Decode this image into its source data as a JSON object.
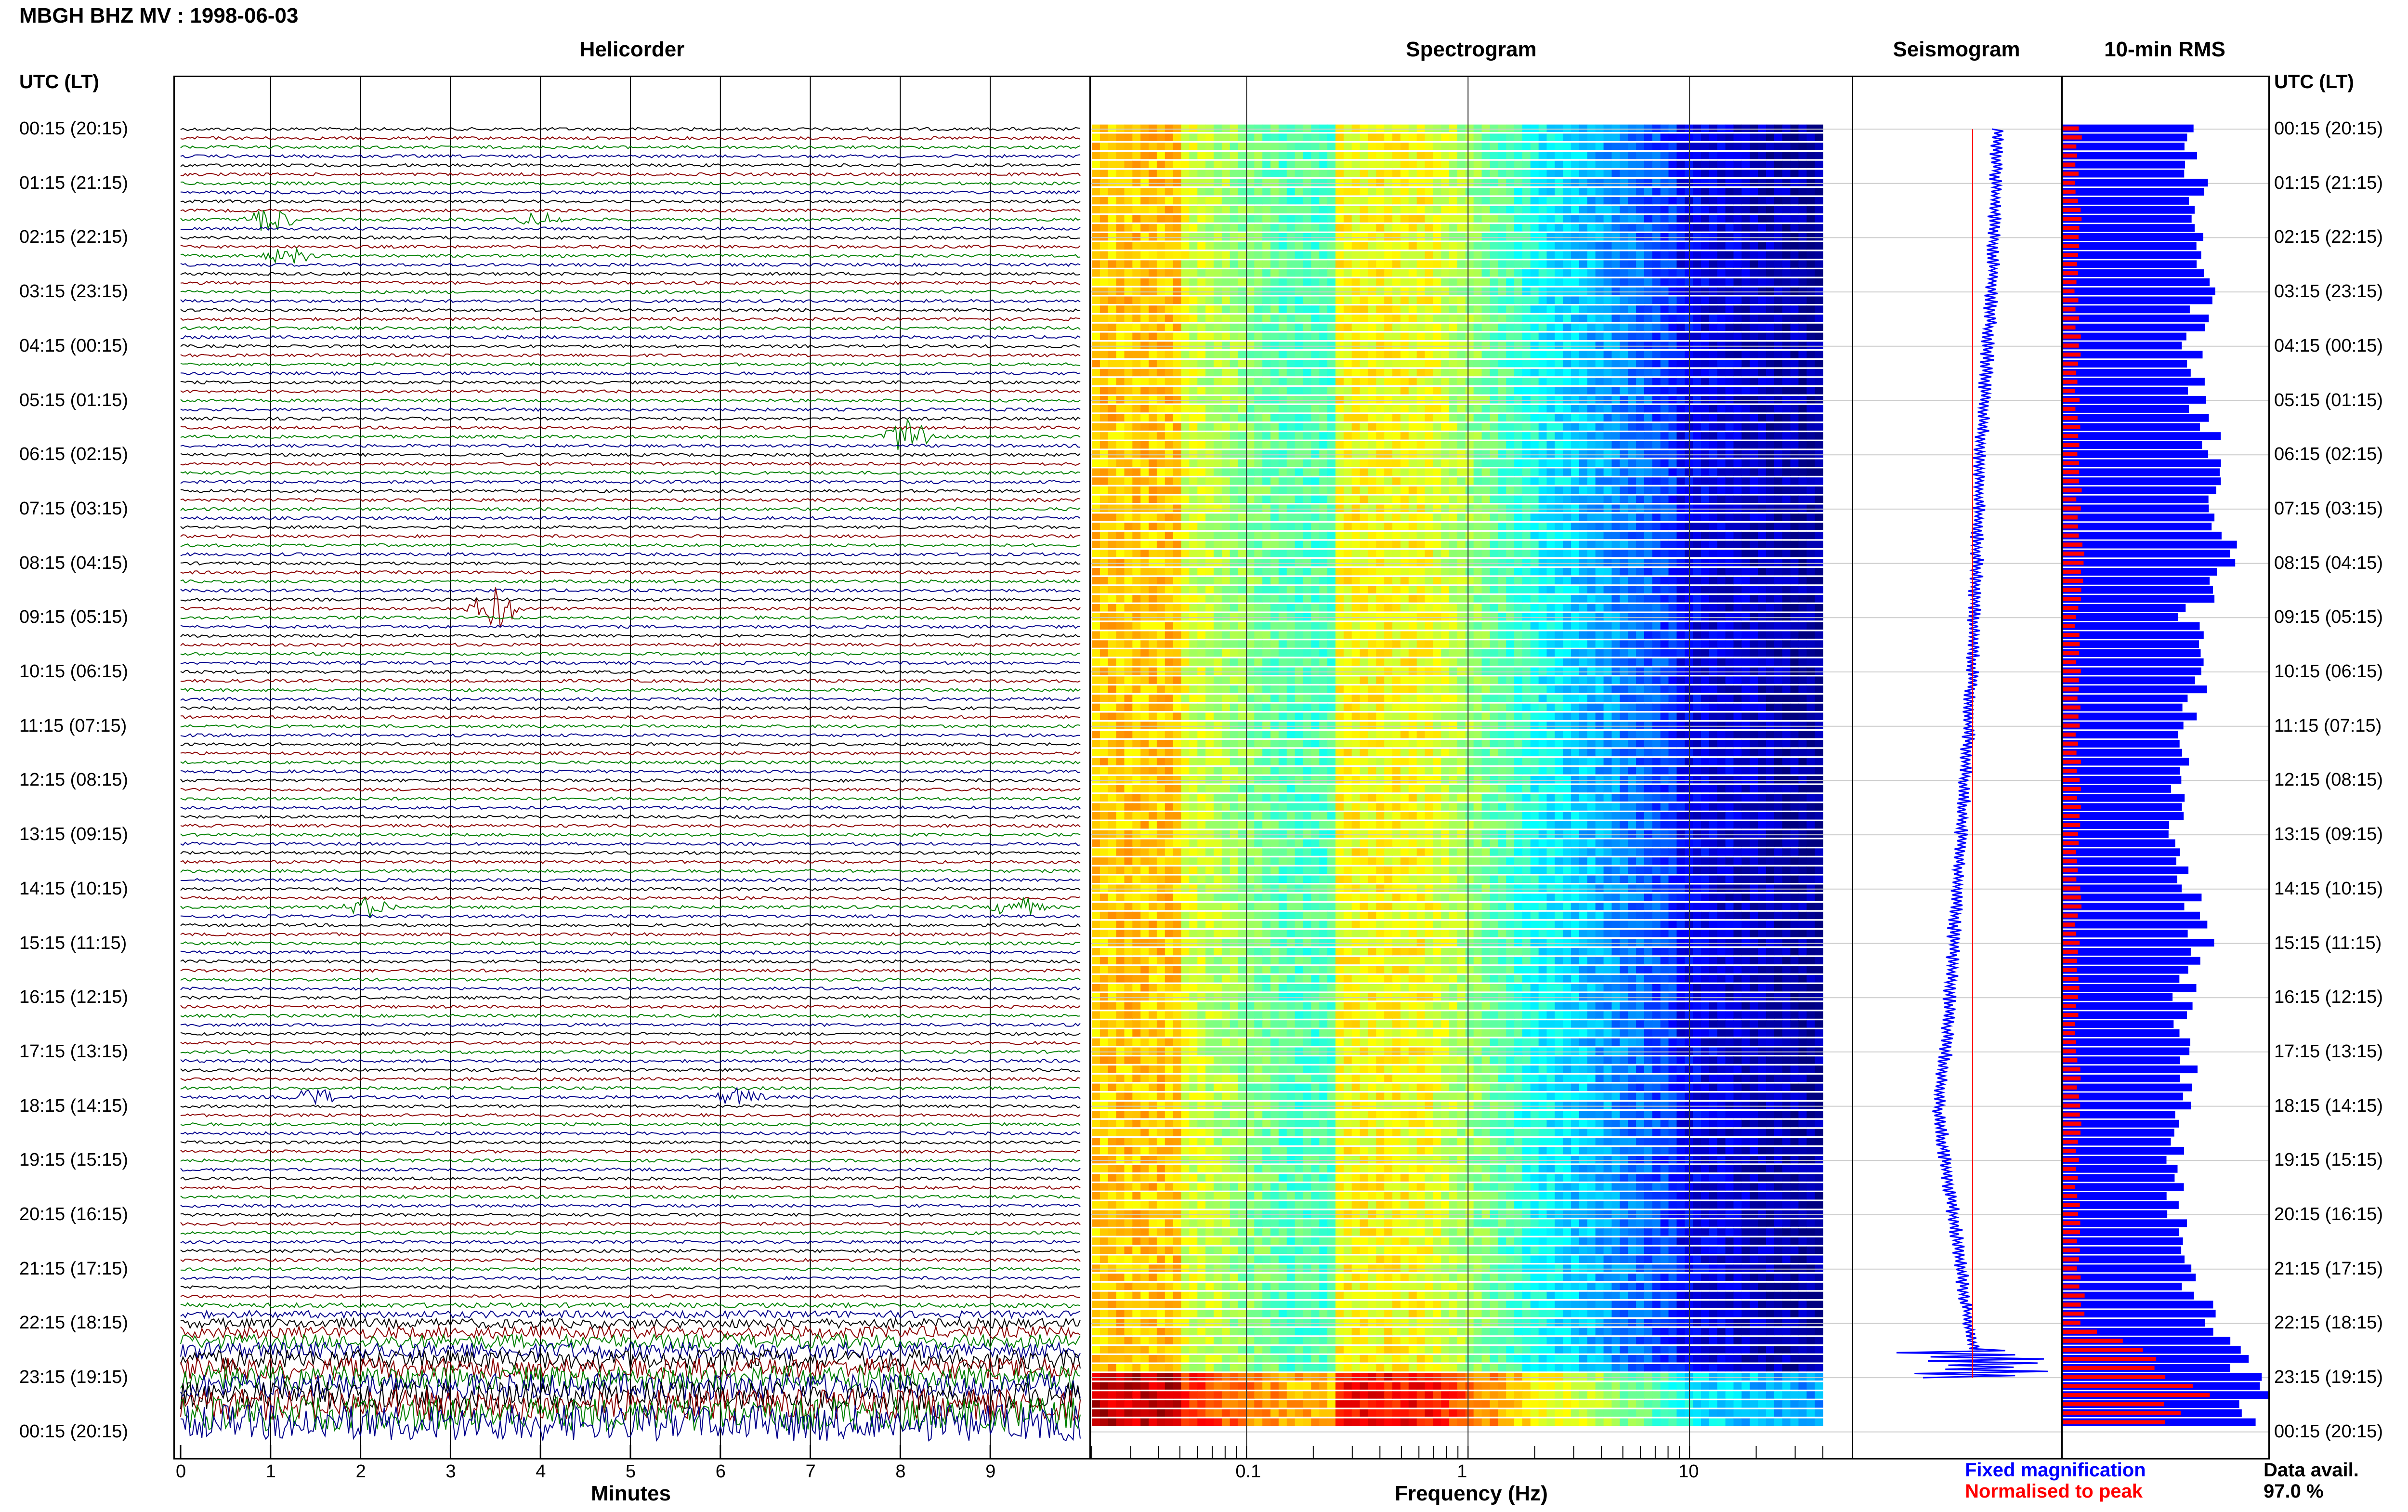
{
  "header": {
    "title": "MBGH BHZ MV : 1998-06-03"
  },
  "panels": {
    "helicorder": {
      "title": "Helicorder",
      "xlabel": "Minutes"
    },
    "spectrogram": {
      "title": "Spectrogram",
      "xlabel": "Frequency (Hz)"
    },
    "seismogram": {
      "title": "Seismogram"
    },
    "rms": {
      "title": "10-min RMS"
    }
  },
  "axis": {
    "left_header": "UTC (LT)",
    "right_header": "UTC (LT)"
  },
  "time_labels": [
    "00:15 (20:15)",
    "01:15 (21:15)",
    "02:15 (22:15)",
    "03:15 (23:15)",
    "04:15 (00:15)",
    "05:15 (01:15)",
    "06:15 (02:15)",
    "07:15 (03:15)",
    "08:15 (04:15)",
    "09:15 (05:15)",
    "10:15 (06:15)",
    "11:15 (07:15)",
    "12:15 (08:15)",
    "13:15 (09:15)",
    "14:15 (10:15)",
    "15:15 (11:15)",
    "16:15 (12:15)",
    "17:15 (13:15)",
    "18:15 (14:15)",
    "19:15 (15:15)",
    "20:15 (16:15)",
    "21:15 (17:15)",
    "22:15 (18:15)",
    "23:15 (19:15)",
    "00:15 (20:15)"
  ],
  "legend": {
    "fixed": "Fixed magnification",
    "normalised": "Normalised to peak",
    "data_avail_label": "Data avail.",
    "data_avail_value": "97.0 %"
  },
  "colors": {
    "fixed": "#0000ff",
    "normalised": "#ff0000",
    "trace_cycle": [
      "#000000",
      "#8b0000",
      "#008000",
      "#00008b"
    ]
  },
  "chart_data": [
    {
      "type": "line",
      "panel": "Helicorder",
      "xlabel": "Minutes",
      "xticks": [
        0,
        1,
        2,
        3,
        4,
        5,
        6,
        7,
        8,
        9
      ],
      "xlim": [
        0,
        10
      ],
      "lines_per_hour": 6,
      "hours": 24,
      "events": [
        {
          "line": 10,
          "minute": 1.0,
          "amp": 1.0
        },
        {
          "line": 10,
          "minute": 4.0,
          "amp": 0.5
        },
        {
          "line": 14,
          "minute": 1.2,
          "amp": 0.6
        },
        {
          "line": 34,
          "minute": 8.1,
          "amp": 1.5
        },
        {
          "line": 53,
          "minute": 3.5,
          "amp": 1.5
        },
        {
          "line": 86,
          "minute": 2.1,
          "amp": 0.7
        },
        {
          "line": 86,
          "minute": 9.3,
          "amp": 0.8
        },
        {
          "line": 107,
          "minute": 1.5,
          "amp": 0.6
        },
        {
          "line": 107,
          "minute": 6.2,
          "amp": 0.6
        }
      ],
      "high_amplitude_from_line": 130
    },
    {
      "type": "heatmap",
      "panel": "Spectrogram",
      "xlabel": "Frequency (Hz)",
      "xscale": "log",
      "xlim": [
        0.02,
        40
      ],
      "xticks": [
        0.1,
        1,
        10
      ],
      "colormap": "jet"
    },
    {
      "type": "line",
      "panel": "Seismogram",
      "series": [
        {
          "name": "Fixed magnification",
          "values": [
            0.15,
            0.14,
            0.13,
            0.12,
            0.1,
            0.08,
            0.06,
            0.05,
            0.04,
            0.03,
            0.02,
            0.0,
            -0.02,
            -0.04,
            -0.06,
            -0.08,
            -0.1,
            -0.12,
            -0.16,
            -0.12,
            -0.08,
            -0.04,
            0.0,
            0.05
          ]
        },
        {
          "name": "Normalised to peak",
          "values": [
            0.02,
            0.02,
            0.02,
            0.02,
            0.02,
            0.02,
            0.02,
            0.02,
            0.02,
            0.02,
            0.02,
            0.02,
            0.02,
            0.02,
            0.02,
            0.02,
            0.02,
            0.02,
            0.02,
            0.02,
            0.02,
            0.02,
            0.02,
            0.02
          ]
        }
      ]
    },
    {
      "type": "bar",
      "panel": "10-min RMS",
      "orientation": "horizontal",
      "series": [
        {
          "name": "Fixed magnification",
          "values": [
            0.6,
            0.65,
            0.7,
            0.68,
            0.62,
            0.66,
            0.72,
            0.7,
            0.85,
            0.62,
            0.68,
            0.6,
            0.58,
            0.55,
            0.62,
            0.68,
            0.58,
            0.6,
            0.6,
            0.55,
            0.55,
            0.58,
            0.72,
            0.92
          ]
        },
        {
          "name": "Normalised to peak",
          "values": [
            0.08,
            0.07,
            0.08,
            0.07,
            0.08,
            0.07,
            0.08,
            0.08,
            0.1,
            0.07,
            0.08,
            0.07,
            0.08,
            0.07,
            0.08,
            0.07,
            0.08,
            0.07,
            0.08,
            0.07,
            0.08,
            0.08,
            0.1,
            0.6
          ]
        }
      ]
    }
  ]
}
